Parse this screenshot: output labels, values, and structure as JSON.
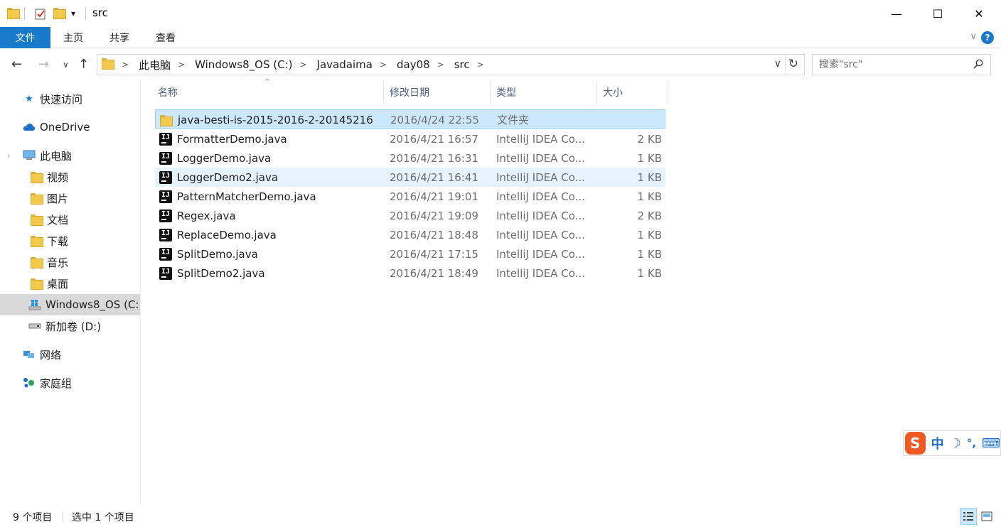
{
  "window": {
    "title": "src",
    "qat_dropdown": "▾",
    "minimize": "—",
    "maximize": "☐",
    "close": "✕"
  },
  "ribbon": {
    "tabs": [
      {
        "label": "文件",
        "active": true
      },
      {
        "label": "主页"
      },
      {
        "label": "共享"
      },
      {
        "label": "查看"
      }
    ],
    "expand": "∨",
    "help": "?"
  },
  "nav": {
    "back": "←",
    "forward": "→",
    "recent": "∨",
    "up": "↑",
    "breadcrumbs": [
      "此电脑",
      "Windows8_OS (C:)",
      "Javadaima",
      "day08",
      "src"
    ],
    "separator": ">",
    "dropdown": "∨",
    "refresh": "↻"
  },
  "search": {
    "placeholder": "搜索\"src\""
  },
  "sidebar": {
    "items": [
      {
        "label": "快速访问",
        "icon": "star-icon"
      },
      {
        "label": "OneDrive",
        "icon": "cloud-icon"
      },
      {
        "label": "此电脑",
        "icon": "computer-icon"
      },
      {
        "label": "视频",
        "icon": "videos-folder-icon"
      },
      {
        "label": "图片",
        "icon": "pictures-folder-icon"
      },
      {
        "label": "文档",
        "icon": "documents-folder-icon"
      },
      {
        "label": "下载",
        "icon": "downloads-folder-icon"
      },
      {
        "label": "音乐",
        "icon": "music-folder-icon"
      },
      {
        "label": "桌面",
        "icon": "desktop-folder-icon"
      },
      {
        "label": "Windows8_OS (C:)",
        "icon": "windows-drive-icon"
      },
      {
        "label": "新加卷 (D:)",
        "icon": "drive-icon"
      },
      {
        "label": "网络",
        "icon": "network-icon"
      },
      {
        "label": "家庭组",
        "icon": "homegroup-icon"
      }
    ]
  },
  "columns": {
    "name": "名称",
    "date": "修改日期",
    "type": "类型",
    "size": "大小"
  },
  "files": [
    {
      "name": "java-besti-is-2015-2016-2-20145216",
      "date": "2016/4/24 22:55",
      "type": "文件夹",
      "size": "",
      "kind": "folder"
    },
    {
      "name": "FormatterDemo.java",
      "date": "2016/4/21 16:57",
      "type": "IntelliJ IDEA Co...",
      "size": "2 KB",
      "kind": "java"
    },
    {
      "name": "LoggerDemo.java",
      "date": "2016/4/21 16:31",
      "type": "IntelliJ IDEA Co...",
      "size": "1 KB",
      "kind": "java"
    },
    {
      "name": "LoggerDemo2.java",
      "date": "2016/4/21 16:41",
      "type": "IntelliJ IDEA Co...",
      "size": "1 KB",
      "kind": "java"
    },
    {
      "name": "PatternMatcherDemo.java",
      "date": "2016/4/21 19:01",
      "type": "IntelliJ IDEA Co...",
      "size": "1 KB",
      "kind": "java"
    },
    {
      "name": "Regex.java",
      "date": "2016/4/21 19:09",
      "type": "IntelliJ IDEA Co...",
      "size": "2 KB",
      "kind": "java"
    },
    {
      "name": "ReplaceDemo.java",
      "date": "2016/4/21 18:48",
      "type": "IntelliJ IDEA Co...",
      "size": "1 KB",
      "kind": "java"
    },
    {
      "name": "SplitDemo.java",
      "date": "2016/4/21 17:15",
      "type": "IntelliJ IDEA Co...",
      "size": "1 KB",
      "kind": "java"
    },
    {
      "name": "SplitDemo2.java",
      "date": "2016/4/21 18:49",
      "type": "IntelliJ IDEA Co...",
      "size": "1 KB",
      "kind": "java"
    }
  ],
  "status": {
    "item_count": "9 个项目",
    "selected": "选中 1 个项目"
  },
  "ime": {
    "logo": "S",
    "mode": "中",
    "moon": "☽",
    "punct": "°,",
    "keyboard": "⌨"
  },
  "colors": {
    "accent": "#1979ca",
    "selection": "#cce8ff",
    "hover": "#e5f3ff",
    "header_text": "#4c607a"
  }
}
